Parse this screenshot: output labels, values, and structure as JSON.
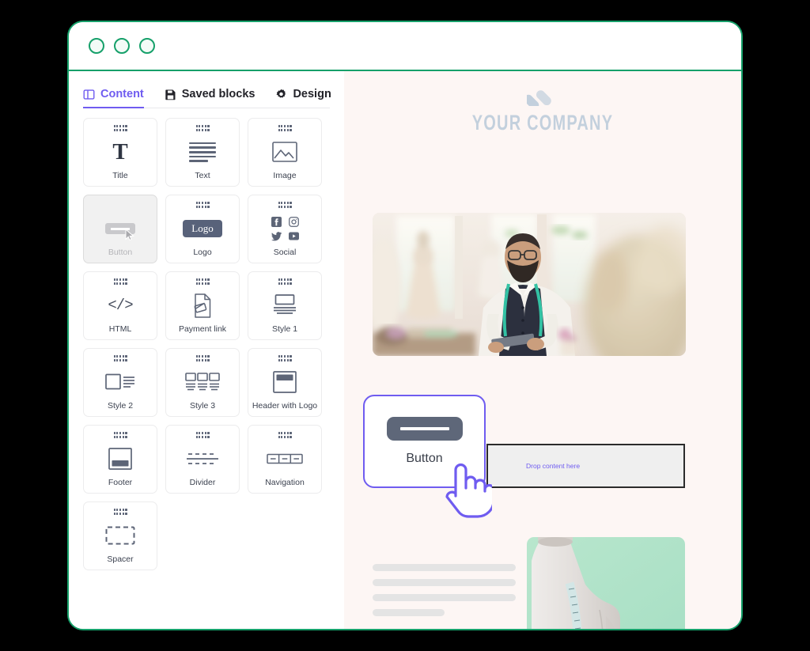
{
  "window": {
    "dots": [
      "window-dot-1",
      "window-dot-2",
      "window-dot-3"
    ],
    "border_color": "#16a06a"
  },
  "sidebar": {
    "tabs": [
      {
        "label": "Content",
        "icon": "columns-icon",
        "active": true
      },
      {
        "label": "Saved blocks",
        "icon": "floppy-disk-icon",
        "active": false
      },
      {
        "label": "Design",
        "icon": "gear-icon",
        "active": false
      }
    ],
    "accent_color": "#6f5cf0",
    "blocks": [
      {
        "label": "Title",
        "icon": "title-icon",
        "state": "normal"
      },
      {
        "label": "Text",
        "icon": "text-lines-icon",
        "state": "normal"
      },
      {
        "label": "Image",
        "icon": "image-icon",
        "state": "normal"
      },
      {
        "label": "Button",
        "icon": "button-icon",
        "state": "dragging"
      },
      {
        "label": "Logo",
        "icon": "logo-icon",
        "state": "normal"
      },
      {
        "label": "Social",
        "icon": "social-icons",
        "state": "normal"
      },
      {
        "label": "HTML",
        "icon": "code-icon",
        "state": "normal"
      },
      {
        "label": "Payment link",
        "icon": "payment-card-icon",
        "state": "normal"
      },
      {
        "label": "Style 1",
        "icon": "style-1-icon",
        "state": "normal"
      },
      {
        "label": "Style 2",
        "icon": "style-2-icon",
        "state": "normal"
      },
      {
        "label": "Style 3",
        "icon": "style-3-icon",
        "state": "normal"
      },
      {
        "label": "Header with Logo",
        "icon": "header-logo-icon",
        "state": "normal"
      },
      {
        "label": "Footer",
        "icon": "footer-icon",
        "state": "normal"
      },
      {
        "label": "Divider",
        "icon": "divider-icon",
        "state": "normal"
      },
      {
        "label": "Navigation",
        "icon": "navigation-icon",
        "state": "normal"
      },
      {
        "label": "Spacer",
        "icon": "spacer-icon",
        "state": "normal"
      }
    ],
    "logo_block_text": "Logo"
  },
  "preview": {
    "background_color": "#fdf6f4",
    "brand_name": "YOUR COMPANY",
    "brand_mark": "chevron-logo-mark",
    "hero_image_alt": "tailor-in-bridal-shop-photo",
    "dropzone_label": "Drop content here",
    "side_image_alt": "dress-form-mannequin-with-measuring-tape-photo",
    "text_placeholder_bars": [
      "full",
      "full",
      "full",
      "half"
    ]
  },
  "drag_overlay": {
    "label": "Button",
    "border_color": "#6f5cf0",
    "cursor": "pointing-hand-cursor"
  }
}
